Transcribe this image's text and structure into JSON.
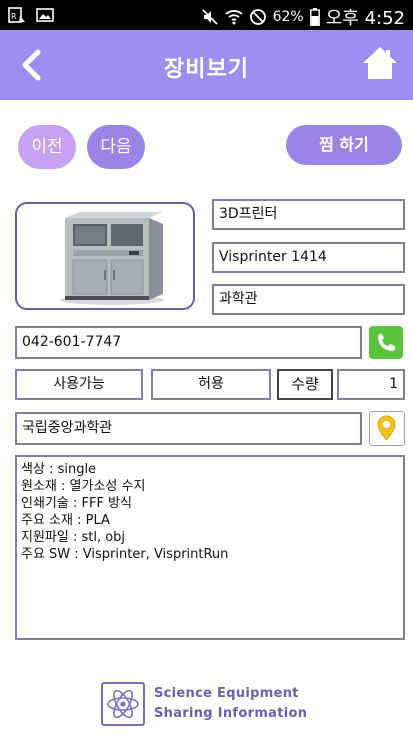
{
  "status_bar": {
    "battery": "62%",
    "time": "오후 4:52",
    "icons": [
      "signal-image-icon",
      "gallery-icon",
      "mute-icon",
      "wifi-icon",
      "no-sim-icon",
      "battery-icon"
    ]
  },
  "header": {
    "title": "장비보기",
    "back_icon": "chevron-left-icon",
    "home_icon": "home-icon",
    "color": "#9d8ff2"
  },
  "nav": {
    "prev_label": "이전",
    "next_label": "다음",
    "wish_label": "찜 하기"
  },
  "equipment": {
    "type": "3D프린터",
    "model": "Visprinter 1414",
    "location": "과학관",
    "phone": "042-601-7747",
    "status": "사용가능",
    "permission": "허용",
    "quantity_label": "수량",
    "quantity": "1",
    "institution": "국립중앙과학관",
    "description": [
      "색상 : single",
      "원소재 : 열가소성 수지",
      "인쇄기술 : FFF 방식",
      "주요 소재 : PLA",
      "지원파일 : stl, obj",
      "주요 SW : Visprinter, VisprintRun"
    ]
  },
  "footer": {
    "logo_line1": "Science Equipment",
    "logo_line2": "Sharing Information"
  }
}
